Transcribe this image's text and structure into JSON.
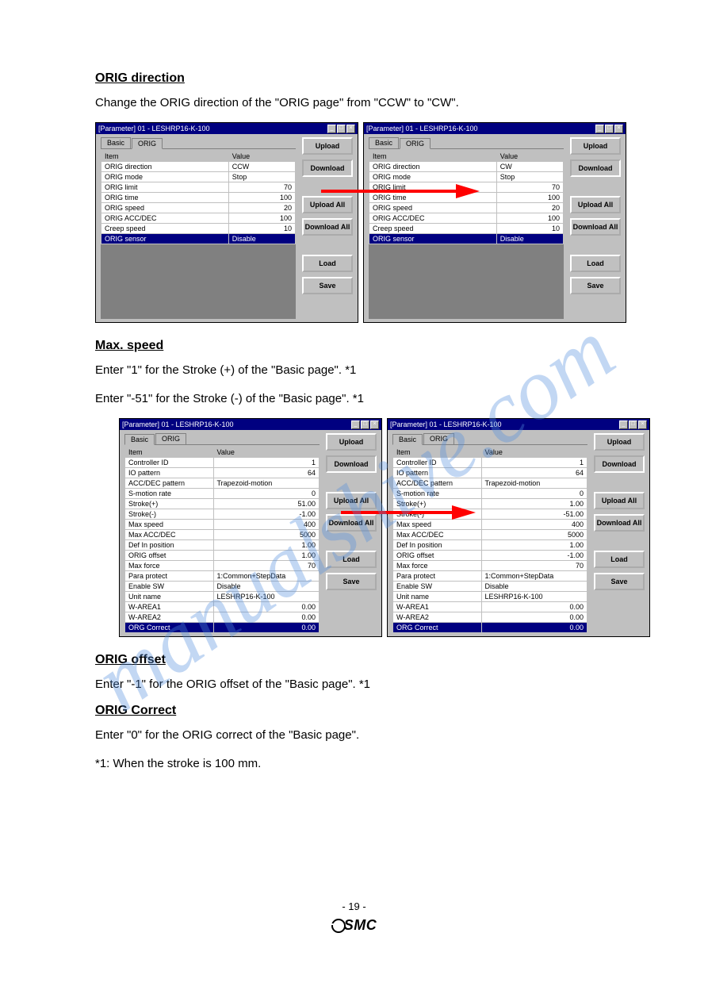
{
  "sections": {
    "s1": {
      "title_label": "ORIG direction",
      "body": "Change the ORIG direction of the \"ORIG page\" from \"CCW\" to \"CW\"."
    },
    "s2": {
      "title_label": "Max. speed",
      "body_a": "Enter \"1\" for the Stroke (+) of the \"Basic page\". *1",
      "body_b": "Enter \"-51\" for the Stroke (-) of the \"Basic page\". *1"
    },
    "s3": {
      "title_label": "ORIG offset",
      "body": "Enter \"-1\" for the ORIG offset of the \"Basic page\". *1"
    },
    "s4": {
      "title_label": "ORIG Correct",
      "body_a": "Enter \"0\" for the ORIG correct of the \"Basic page\".",
      "body_b": "*1: When the stroke is 100 mm."
    }
  },
  "window_title": "[Parameter] 01 - LESHRP16-K-100",
  "tabs": {
    "basic": "Basic",
    "orig": "ORIG"
  },
  "buttons": {
    "upload": "Upload",
    "download": "Download",
    "uploadAll": "Upload All",
    "downloadAll": "Download All",
    "load": "Load",
    "save": "Save"
  },
  "table_header": {
    "item": "Item",
    "value": "Value"
  },
  "orig_rows": [
    {
      "item": "ORIG direction",
      "valueL": "CCW",
      "value": ""
    },
    {
      "item": "ORIG mode",
      "valueL": "Stop",
      "value": ""
    },
    {
      "item": "ORIG limit",
      "valueL": "",
      "value": "70"
    },
    {
      "item": "ORIG time",
      "valueL": "",
      "value": "100"
    },
    {
      "item": "ORIG speed",
      "valueL": "",
      "value": "20"
    },
    {
      "item": "ORIG ACC/DEC",
      "valueL": "",
      "value": "100"
    },
    {
      "item": "Creep speed",
      "valueL": "",
      "value": "10"
    },
    {
      "item": "ORIG sensor",
      "valueL": "Disable",
      "value": ""
    }
  ],
  "orig_rows_after": [
    {
      "item": "ORIG direction",
      "valueL": "CW",
      "value": ""
    },
    {
      "item": "ORIG mode",
      "valueL": "Stop",
      "value": ""
    },
    {
      "item": "ORIG limit",
      "valueL": "",
      "value": "70"
    },
    {
      "item": "ORIG time",
      "valueL": "",
      "value": "100"
    },
    {
      "item": "ORIG speed",
      "valueL": "",
      "value": "20"
    },
    {
      "item": "ORIG ACC/DEC",
      "valueL": "",
      "value": "100"
    },
    {
      "item": "Creep speed",
      "valueL": "",
      "value": "10"
    },
    {
      "item": "ORIG sensor",
      "valueL": "Disable",
      "value": ""
    }
  ],
  "basic_rows_before": [
    {
      "item": "Controller ID",
      "valueL": "",
      "value": "1"
    },
    {
      "item": "IO pattern",
      "valueL": "",
      "value": "64"
    },
    {
      "item": "ACC/DEC pattern",
      "valueL": "Trapezoid-motion",
      "value": ""
    },
    {
      "item": "S-motion rate",
      "valueL": "",
      "value": "0"
    },
    {
      "item": "Stroke(+)",
      "valueL": "",
      "value": "51.00"
    },
    {
      "item": "Stroke(-)",
      "valueL": "",
      "value": "-1.00"
    },
    {
      "item": "Max speed",
      "valueL": "",
      "value": "400"
    },
    {
      "item": "Max ACC/DEC",
      "valueL": "",
      "value": "5000"
    },
    {
      "item": "Def In position",
      "valueL": "",
      "value": "1.00"
    },
    {
      "item": "ORIG offset",
      "valueL": "",
      "value": "1.00"
    },
    {
      "item": "Max force",
      "valueL": "",
      "value": "70"
    },
    {
      "item": "Para protect",
      "valueL": "1:Common+StepData",
      "value": ""
    },
    {
      "item": "Enable SW",
      "valueL": "Disable",
      "value": ""
    },
    {
      "item": "Unit name",
      "valueL": "LESHRP16-K-100",
      "value": ""
    },
    {
      "item": "W-AREA1",
      "valueL": "",
      "value": "0.00"
    },
    {
      "item": "W-AREA2",
      "valueL": "",
      "value": "0.00"
    },
    {
      "item": "ORG Correct",
      "valueL": "",
      "value": "0.00"
    }
  ],
  "basic_rows_after": [
    {
      "item": "Controller ID",
      "valueL": "",
      "value": "1"
    },
    {
      "item": "IO pattern",
      "valueL": "",
      "value": "64"
    },
    {
      "item": "ACC/DEC pattern",
      "valueL": "Trapezoid-motion",
      "value": ""
    },
    {
      "item": "S-motion rate",
      "valueL": "",
      "value": "0"
    },
    {
      "item": "Stroke(+)",
      "valueL": "",
      "value": "1.00"
    },
    {
      "item": "Stroke(-)",
      "valueL": "",
      "value": "-51.00"
    },
    {
      "item": "Max speed",
      "valueL": "",
      "value": "400"
    },
    {
      "item": "Max ACC/DEC",
      "valueL": "",
      "value": "5000"
    },
    {
      "item": "Def In position",
      "valueL": "",
      "value": "1.00"
    },
    {
      "item": "ORIG offset",
      "valueL": "",
      "value": "-1.00"
    },
    {
      "item": "Max force",
      "valueL": "",
      "value": "70"
    },
    {
      "item": "Para protect",
      "valueL": "1:Common+StepData",
      "value": ""
    },
    {
      "item": "Enable SW",
      "valueL": "Disable",
      "value": ""
    },
    {
      "item": "Unit name",
      "valueL": "LESHRP16-K-100",
      "value": ""
    },
    {
      "item": "W-AREA1",
      "valueL": "",
      "value": "0.00"
    },
    {
      "item": "W-AREA2",
      "valueL": "",
      "value": "0.00"
    },
    {
      "item": "ORG Correct",
      "valueL": "",
      "value": "0.00"
    }
  ],
  "orig_sel_idx": 7,
  "basic_sel_idx": 16,
  "watermark": "manualshive.com",
  "page_number": "- 19 -",
  "logo_text": "SMC"
}
